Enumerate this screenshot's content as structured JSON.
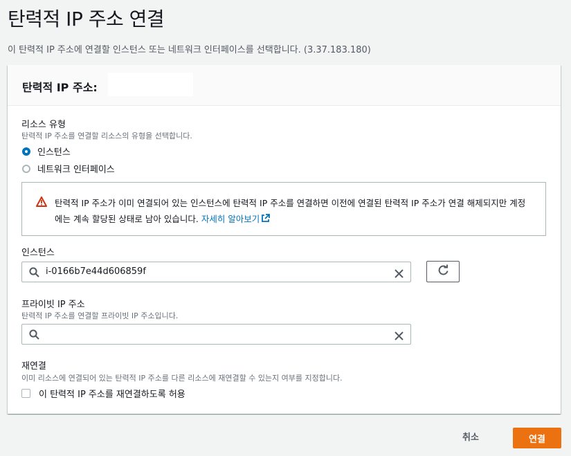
{
  "page": {
    "title": "탄력적 IP 주소 연결",
    "description": "이 탄력적 IP 주소에 연결할 인스턴스 또는 네트워크 인터페이스를 선택합니다. (3.37.183.180)"
  },
  "panel": {
    "title": "탄력적 IP 주소:",
    "resource_type": {
      "label": "리소스 유형",
      "description": "탄력적 IP 주소를 연결할 리소스의 유형을 선택합니다.",
      "options": [
        "인스턴스",
        "네트워크 인터페이스"
      ],
      "selected": "인스턴스"
    },
    "alert": {
      "text": "탄력적 IP 주소가 이미 연결되어 있는 인스턴스에 탄력적 IP 주소를 연결하면 이전에 연결된 탄력적 IP 주소가 연결 해제되지만 계정에는 계속 할당된 상태로 남아 있습니다.",
      "link": "자세히 알아보기"
    },
    "instance": {
      "label": "인스턴스",
      "value": "i-0166b7e44d606859f"
    },
    "private_ip": {
      "label": "프라이빗 IP 주소",
      "description": "탄력적 IP 주소를 연결할 프라이빗 IP 주소입니다.",
      "value": ""
    },
    "reassociate": {
      "label": "재연결",
      "description": "이미 리소스에 연결되어 있는 탄력적 IP 주소를 다른 리소스에 재연결할 수 있는지 여부를 지정합니다.",
      "checkbox_label": "이 탄력적 IP 주소를 재연결하도록 허용",
      "checked": false
    }
  },
  "footer": {
    "cancel_label": "취소",
    "connect_label": "연결"
  },
  "colors": {
    "accent": "#0073bb",
    "primary_button": "#ec7211",
    "warning_icon": "#d13212"
  }
}
